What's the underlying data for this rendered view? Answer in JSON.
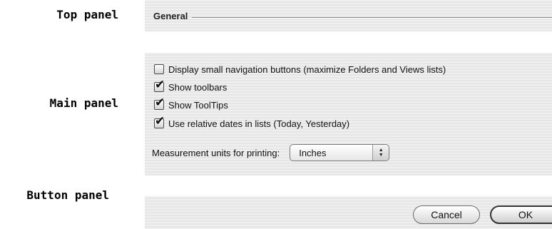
{
  "labels": {
    "top_panel": "Top panel",
    "main_panel": "Main panel",
    "button_panel": "Button panel"
  },
  "group": {
    "title": "General"
  },
  "options": [
    {
      "label": "Display small navigation buttons (maximize Folders and Views lists)",
      "checked": false
    },
    {
      "label": "Show toolbars",
      "checked": true
    },
    {
      "label": "Show ToolTips",
      "checked": true
    },
    {
      "label": "Use relative dates in lists (Today, Yesterday)",
      "checked": true
    }
  ],
  "measurement": {
    "label": "Measurement units for printing:",
    "value": "Inches"
  },
  "buttons": {
    "cancel": "Cancel",
    "ok": "OK"
  },
  "icons": {
    "checkmark": "✔",
    "popup_up": "▲",
    "popup_down": "▼"
  }
}
